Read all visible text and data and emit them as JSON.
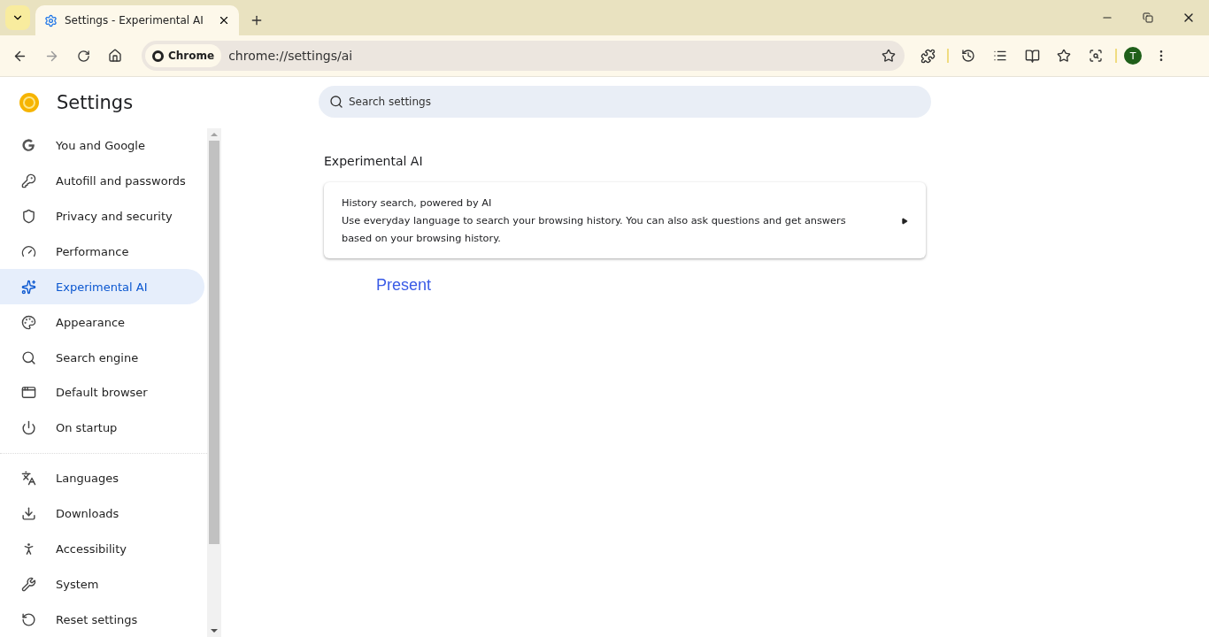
{
  "browser": {
    "tab": {
      "title": "Settings - Experimental AI",
      "selected": true
    },
    "omnibox": {
      "chip": "Chrome",
      "url": "chrome://settings/ai"
    },
    "profile": {
      "initial": "T"
    }
  },
  "header": {
    "title": "Settings"
  },
  "search": {
    "placeholder": "Search settings"
  },
  "sidebar": {
    "groups": [
      {
        "items": [
          {
            "label": "You and Google",
            "selected": false
          },
          {
            "label": "Autofill and passwords",
            "selected": false
          },
          {
            "label": "Privacy and security",
            "selected": false
          },
          {
            "label": "Performance",
            "selected": false
          },
          {
            "label": "Experimental AI",
            "selected": true
          },
          {
            "label": "Appearance",
            "selected": false
          },
          {
            "label": "Search engine",
            "selected": false
          },
          {
            "label": "Default browser",
            "selected": false
          },
          {
            "label": "On startup",
            "selected": false
          }
        ]
      },
      {
        "items": [
          {
            "label": "Languages",
            "selected": false
          },
          {
            "label": "Downloads",
            "selected": false
          },
          {
            "label": "Accessibility",
            "selected": false
          },
          {
            "label": "System",
            "selected": false
          },
          {
            "label": "Reset settings",
            "selected": false
          }
        ]
      }
    ]
  },
  "section": {
    "title": "Experimental AI",
    "card": {
      "title": "History search, powered by AI",
      "description": "Use everyday language to search your browsing history. You can also ask questions and get answers based on your browsing history."
    }
  },
  "present": "Present"
}
